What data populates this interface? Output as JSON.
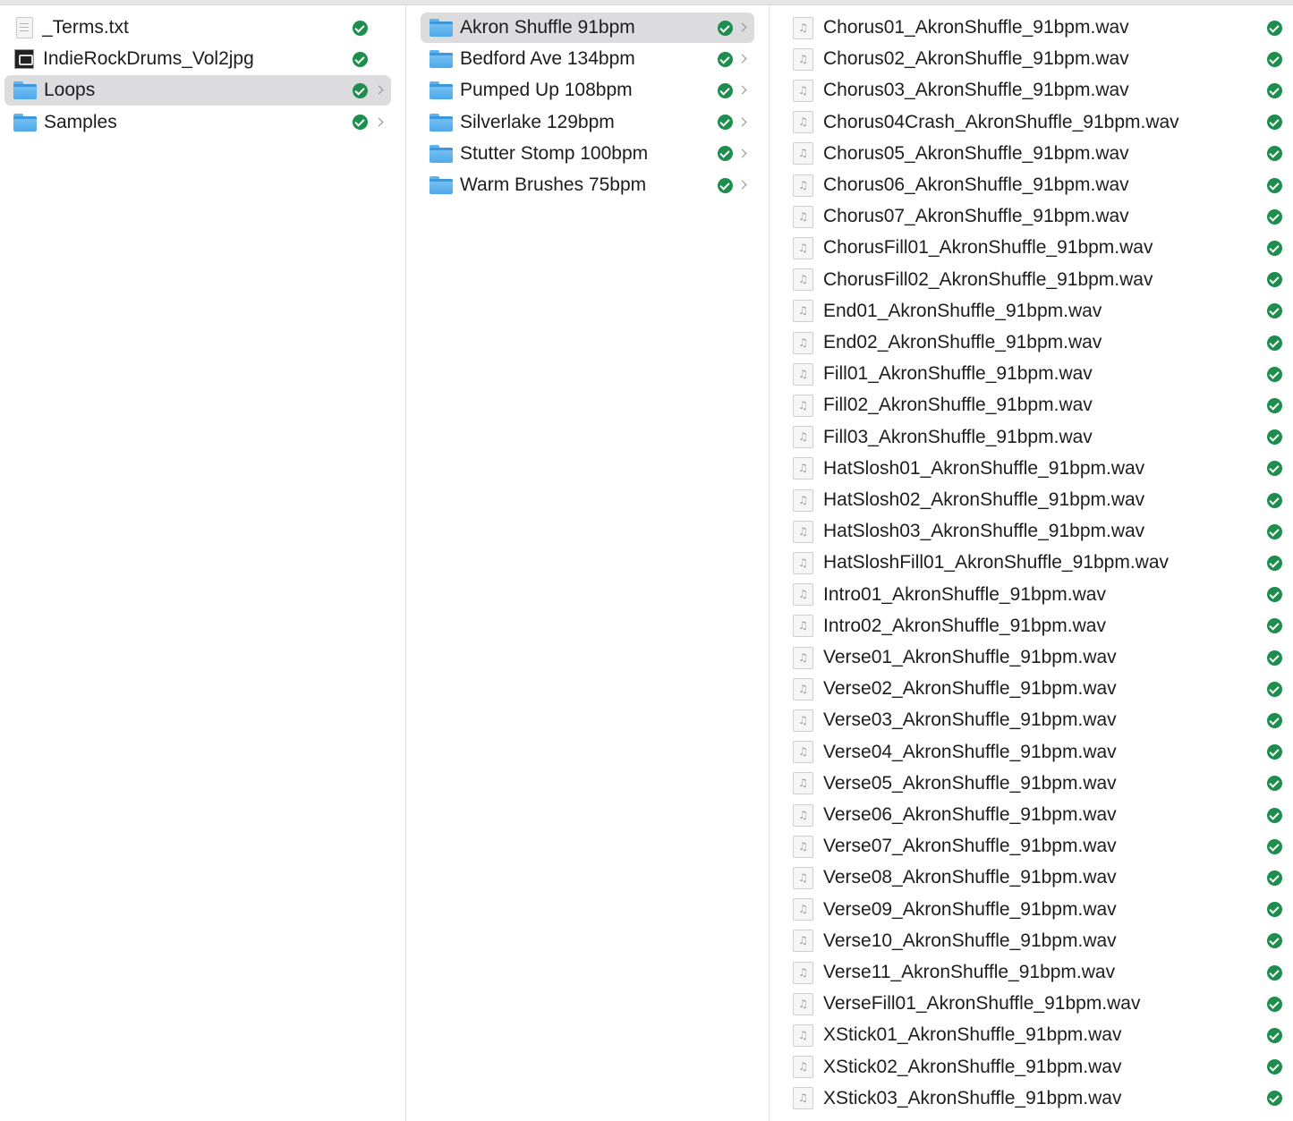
{
  "columns": [
    {
      "items": [
        {
          "name": "_Terms.txt",
          "kind": "document",
          "icon": "text-file-icon",
          "status": "synced",
          "selected": false,
          "has_children": false
        },
        {
          "name": "IndieRockDrums_Vol2jpg",
          "kind": "image",
          "icon": "image-file-icon",
          "status": "synced",
          "selected": false,
          "has_children": false
        },
        {
          "name": "Loops",
          "kind": "folder",
          "icon": "folder-icon",
          "status": "synced",
          "selected": true,
          "has_children": true
        },
        {
          "name": "Samples",
          "kind": "folder",
          "icon": "folder-icon",
          "status": "synced",
          "selected": false,
          "has_children": true
        }
      ]
    },
    {
      "items": [
        {
          "name": "Akron Shuffle 91bpm",
          "kind": "folder",
          "icon": "folder-icon",
          "status": "synced",
          "selected": true,
          "has_children": true
        },
        {
          "name": "Bedford Ave 134bpm",
          "kind": "folder",
          "icon": "folder-icon",
          "status": "synced",
          "selected": false,
          "has_children": true
        },
        {
          "name": "Pumped Up 108bpm",
          "kind": "folder",
          "icon": "folder-icon",
          "status": "synced",
          "selected": false,
          "has_children": true
        },
        {
          "name": "Silverlake 129bpm",
          "kind": "folder",
          "icon": "folder-icon",
          "status": "synced",
          "selected": false,
          "has_children": true
        },
        {
          "name": "Stutter Stomp 100bpm",
          "kind": "folder",
          "icon": "folder-icon",
          "status": "synced",
          "selected": false,
          "has_children": true
        },
        {
          "name": "Warm Brushes 75bpm",
          "kind": "folder",
          "icon": "folder-icon",
          "status": "synced",
          "selected": false,
          "has_children": true
        }
      ]
    },
    {
      "items": [
        {
          "name": "Chorus01_AkronShuffle_91bpm.wav",
          "kind": "audio",
          "icon": "audio-file-icon",
          "status": "synced"
        },
        {
          "name": "Chorus02_AkronShuffle_91bpm.wav",
          "kind": "audio",
          "icon": "audio-file-icon",
          "status": "synced"
        },
        {
          "name": "Chorus03_AkronShuffle_91bpm.wav",
          "kind": "audio",
          "icon": "audio-file-icon",
          "status": "synced"
        },
        {
          "name": "Chorus04Crash_AkronShuffle_91bpm.wav",
          "kind": "audio",
          "icon": "audio-file-icon",
          "status": "synced"
        },
        {
          "name": "Chorus05_AkronShuffle_91bpm.wav",
          "kind": "audio",
          "icon": "audio-file-icon",
          "status": "synced"
        },
        {
          "name": "Chorus06_AkronShuffle_91bpm.wav",
          "kind": "audio",
          "icon": "audio-file-icon",
          "status": "synced"
        },
        {
          "name": "Chorus07_AkronShuffle_91bpm.wav",
          "kind": "audio",
          "icon": "audio-file-icon",
          "status": "synced"
        },
        {
          "name": "ChorusFill01_AkronShuffle_91bpm.wav",
          "kind": "audio",
          "icon": "audio-file-icon",
          "status": "synced"
        },
        {
          "name": "ChorusFill02_AkronShuffle_91bpm.wav",
          "kind": "audio",
          "icon": "audio-file-icon",
          "status": "synced"
        },
        {
          "name": "End01_AkronShuffle_91bpm.wav",
          "kind": "audio",
          "icon": "audio-file-icon",
          "status": "synced"
        },
        {
          "name": "End02_AkronShuffle_91bpm.wav",
          "kind": "audio",
          "icon": "audio-file-icon",
          "status": "synced"
        },
        {
          "name": "Fill01_AkronShuffle_91bpm.wav",
          "kind": "audio",
          "icon": "audio-file-icon",
          "status": "synced"
        },
        {
          "name": "Fill02_AkronShuffle_91bpm.wav",
          "kind": "audio",
          "icon": "audio-file-icon",
          "status": "synced"
        },
        {
          "name": "Fill03_AkronShuffle_91bpm.wav",
          "kind": "audio",
          "icon": "audio-file-icon",
          "status": "synced"
        },
        {
          "name": "HatSlosh01_AkronShuffle_91bpm.wav",
          "kind": "audio",
          "icon": "audio-file-icon",
          "status": "synced"
        },
        {
          "name": "HatSlosh02_AkronShuffle_91bpm.wav",
          "kind": "audio",
          "icon": "audio-file-icon",
          "status": "synced"
        },
        {
          "name": "HatSlosh03_AkronShuffle_91bpm.wav",
          "kind": "audio",
          "icon": "audio-file-icon",
          "status": "synced"
        },
        {
          "name": "HatSloshFill01_AkronShuffle_91bpm.wav",
          "kind": "audio",
          "icon": "audio-file-icon",
          "status": "synced"
        },
        {
          "name": "Intro01_AkronShuffle_91bpm.wav",
          "kind": "audio",
          "icon": "audio-file-icon",
          "status": "synced"
        },
        {
          "name": "Intro02_AkronShuffle_91bpm.wav",
          "kind": "audio",
          "icon": "audio-file-icon",
          "status": "synced"
        },
        {
          "name": "Verse01_AkronShuffle_91bpm.wav",
          "kind": "audio",
          "icon": "audio-file-icon",
          "status": "synced"
        },
        {
          "name": "Verse02_AkronShuffle_91bpm.wav",
          "kind": "audio",
          "icon": "audio-file-icon",
          "status": "synced"
        },
        {
          "name": "Verse03_AkronShuffle_91bpm.wav",
          "kind": "audio",
          "icon": "audio-file-icon",
          "status": "synced"
        },
        {
          "name": "Verse04_AkronShuffle_91bpm.wav",
          "kind": "audio",
          "icon": "audio-file-icon",
          "status": "synced"
        },
        {
          "name": "Verse05_AkronShuffle_91bpm.wav",
          "kind": "audio",
          "icon": "audio-file-icon",
          "status": "synced"
        },
        {
          "name": "Verse06_AkronShuffle_91bpm.wav",
          "kind": "audio",
          "icon": "audio-file-icon",
          "status": "synced"
        },
        {
          "name": "Verse07_AkronShuffle_91bpm.wav",
          "kind": "audio",
          "icon": "audio-file-icon",
          "status": "synced"
        },
        {
          "name": "Verse08_AkronShuffle_91bpm.wav",
          "kind": "audio",
          "icon": "audio-file-icon",
          "status": "synced"
        },
        {
          "name": "Verse09_AkronShuffle_91bpm.wav",
          "kind": "audio",
          "icon": "audio-file-icon",
          "status": "synced"
        },
        {
          "name": "Verse10_AkronShuffle_91bpm.wav",
          "kind": "audio",
          "icon": "audio-file-icon",
          "status": "synced"
        },
        {
          "name": "Verse11_AkronShuffle_91bpm.wav",
          "kind": "audio",
          "icon": "audio-file-icon",
          "status": "synced"
        },
        {
          "name": "VerseFill01_AkronShuffle_91bpm.wav",
          "kind": "audio",
          "icon": "audio-file-icon",
          "status": "synced"
        },
        {
          "name": "XStick01_AkronShuffle_91bpm.wav",
          "kind": "audio",
          "icon": "audio-file-icon",
          "status": "synced"
        },
        {
          "name": "XStick02_AkronShuffle_91bpm.wav",
          "kind": "audio",
          "icon": "audio-file-icon",
          "status": "synced"
        },
        {
          "name": "XStick03_AkronShuffle_91bpm.wav",
          "kind": "audio",
          "icon": "audio-file-icon",
          "status": "synced"
        }
      ]
    }
  ],
  "colors": {
    "selection": "#dcdcde",
    "sync_ok": "#1e8e4e",
    "folder": "#5fb3ee",
    "text": "#1d1d1f"
  },
  "icons": {
    "status": "checkmark-circle-icon",
    "expand": "chevron-right-icon"
  }
}
